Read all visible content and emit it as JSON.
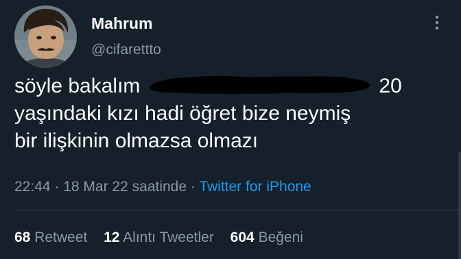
{
  "user": {
    "display_name": "Mahrum",
    "handle": "@cifaretttо"
  },
  "tweet": {
    "line1_start": "söyle bakalım",
    "line1_end": "20",
    "line2": "yaşındaki kızı hadi öğret bize neymiş",
    "line3": "bir ilişkinin olmazsa olmazı"
  },
  "meta": {
    "time": "22:44",
    "separator1": " · ",
    "date": "18 Mar 22 saatinde",
    "separator2": " · ",
    "source": "Twitter for iPhone"
  },
  "stats": [
    {
      "count": "68",
      "label": "Retweet"
    },
    {
      "count": "12",
      "label": "Alıntı Tweetler"
    },
    {
      "count": "604",
      "label": "Beğeni"
    }
  ],
  "icons": {
    "more": "vertical-ellipsis"
  },
  "colors": {
    "background": "#15202b",
    "text": "#ffffff",
    "muted": "#8b98a5",
    "link": "#1d9bf0",
    "divider": "#38444d"
  }
}
